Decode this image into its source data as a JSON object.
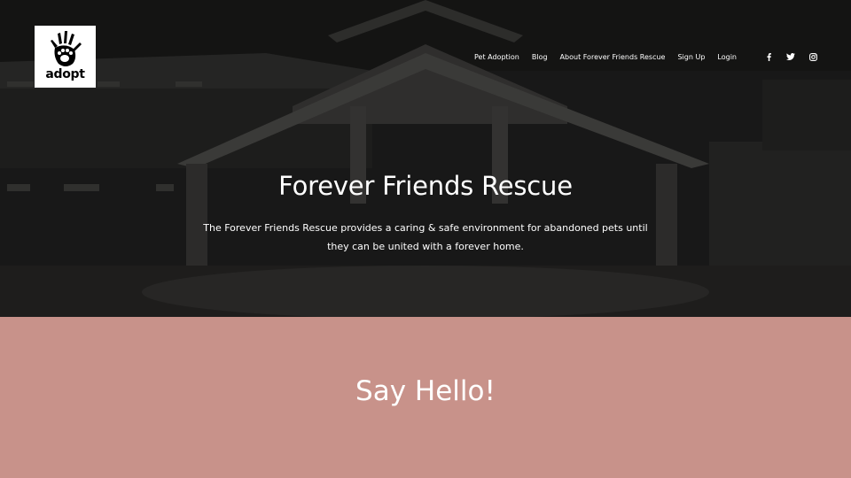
{
  "logo": {
    "text": "adopt",
    "icon": "handprint-paw-icon"
  },
  "nav": {
    "items": [
      {
        "label": "Pet Adoption"
      },
      {
        "label": "Blog"
      },
      {
        "label": "About Forever Friends Rescue"
      },
      {
        "label": "Sign Up"
      },
      {
        "label": "Login"
      }
    ],
    "socials": [
      "facebook-icon",
      "twitter-icon",
      "instagram-icon"
    ]
  },
  "hero": {
    "title": "Forever Friends Rescue",
    "description": "The Forever Friends Rescue provides a caring & safe environment for abandoned pets until they can be united with a forever home."
  },
  "hello": {
    "title": "Say Hello!"
  },
  "colors": {
    "accent": "#c8928a",
    "text": "#ffffff",
    "hero_dark": "#262626"
  }
}
